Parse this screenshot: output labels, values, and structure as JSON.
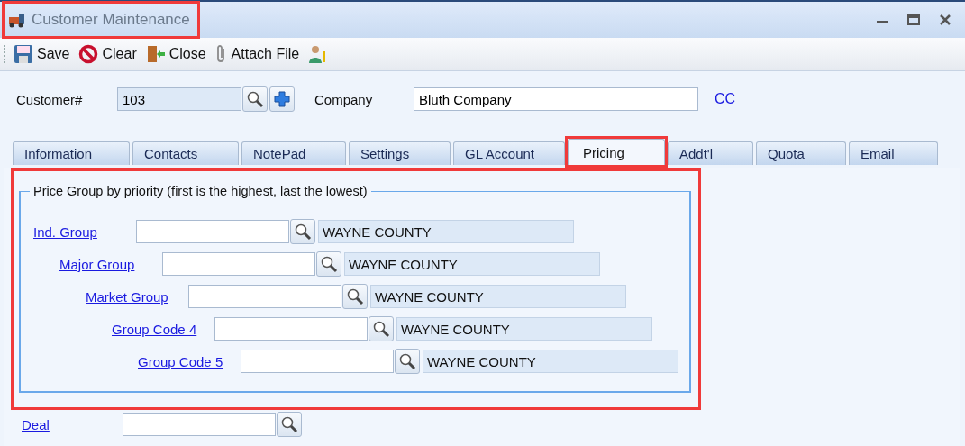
{
  "window": {
    "title": "Customer Maintenance",
    "title_highlighted": true
  },
  "toolbar": [
    {
      "kind": "save",
      "label": "Save"
    },
    {
      "kind": "clear",
      "label": "Clear"
    },
    {
      "kind": "close",
      "label": "Close"
    },
    {
      "kind": "attach",
      "label": "Attach File"
    },
    {
      "kind": "user"
    }
  ],
  "customer": {
    "label": "Customer#",
    "value": "103",
    "company_label": "Company",
    "company_value": "Bluth Company",
    "link": "CC"
  },
  "tabs": [
    {
      "label": "Information",
      "selected": false,
      "highlighted": false
    },
    {
      "label": "Contacts",
      "selected": false,
      "highlighted": false
    },
    {
      "label": "NotePad",
      "selected": false,
      "highlighted": false
    },
    {
      "label": "Settings",
      "selected": false,
      "highlighted": false
    },
    {
      "label": "GL Account",
      "selected": false,
      "highlighted": false
    },
    {
      "label": "Pricing",
      "selected": true,
      "highlighted": true
    },
    {
      "label": "Addt'l",
      "selected": false,
      "highlighted": false
    },
    {
      "label": "Quota",
      "selected": false,
      "highlighted": false
    },
    {
      "label": "Email",
      "selected": false,
      "highlighted": false
    }
  ],
  "price_group": {
    "title": "Price Group by priority (first is the highest, last the lowest)",
    "highlighted": true,
    "rows": [
      {
        "label": "Ind. Group",
        "description": "WAYNE COUNTY"
      },
      {
        "label": "Major Group",
        "description": "WAYNE COUNTY"
      },
      {
        "label": "Market Group",
        "description": "WAYNE COUNTY"
      },
      {
        "label": "Group Code 4",
        "description": "WAYNE COUNTY"
      },
      {
        "label": "Group Code 5",
        "description": "WAYNE COUNTY"
      }
    ]
  },
  "deal": {
    "label": "Deal"
  }
}
